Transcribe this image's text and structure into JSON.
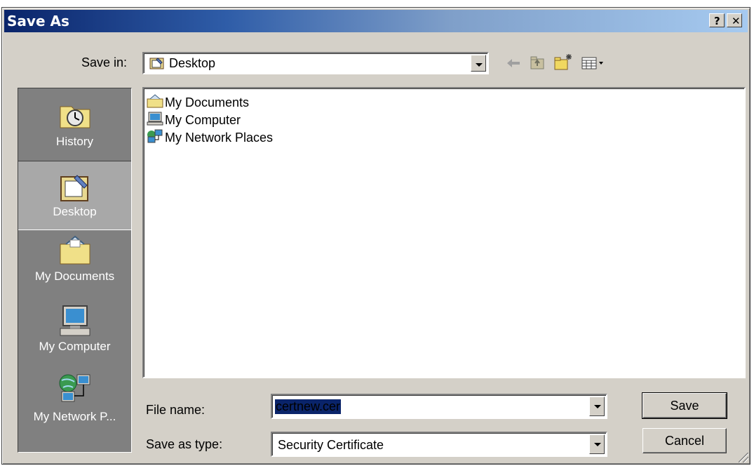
{
  "window": {
    "title": "Save As",
    "help_label": "?",
    "close_label": "✕"
  },
  "save_in": {
    "label": "Save in:",
    "value": "Desktop"
  },
  "toolbar": {
    "icons": [
      "back-icon",
      "up-one-level-icon",
      "create-new-folder-icon",
      "view-menu-icon"
    ]
  },
  "places_bar": {
    "items": [
      {
        "label": "History",
        "icon": "history-icon"
      },
      {
        "label": "Desktop",
        "icon": "desktop-icon",
        "selected": true
      },
      {
        "label": "My Documents",
        "icon": "my-documents-icon"
      },
      {
        "label": "My Computer",
        "icon": "my-computer-icon"
      },
      {
        "label": "My Network P...",
        "icon": "my-network-places-icon"
      }
    ]
  },
  "file_list": {
    "items": [
      {
        "label": "My Documents",
        "icon": "my-documents-icon"
      },
      {
        "label": "My Computer",
        "icon": "my-computer-icon"
      },
      {
        "label": "My Network Places",
        "icon": "my-network-places-icon"
      }
    ]
  },
  "file_name": {
    "label": "File name:",
    "value": "certnew.cer"
  },
  "save_as_type": {
    "label": "Save as type:",
    "value": "Security Certificate"
  },
  "buttons": {
    "save": "Save",
    "cancel": "Cancel"
  },
  "colors": {
    "title_bar_start": "#0a246a",
    "title_bar_end": "#a6caf0",
    "dialog_face": "#d4d0c8",
    "places_bar_bg": "#808080",
    "selection": "#0a246a"
  }
}
